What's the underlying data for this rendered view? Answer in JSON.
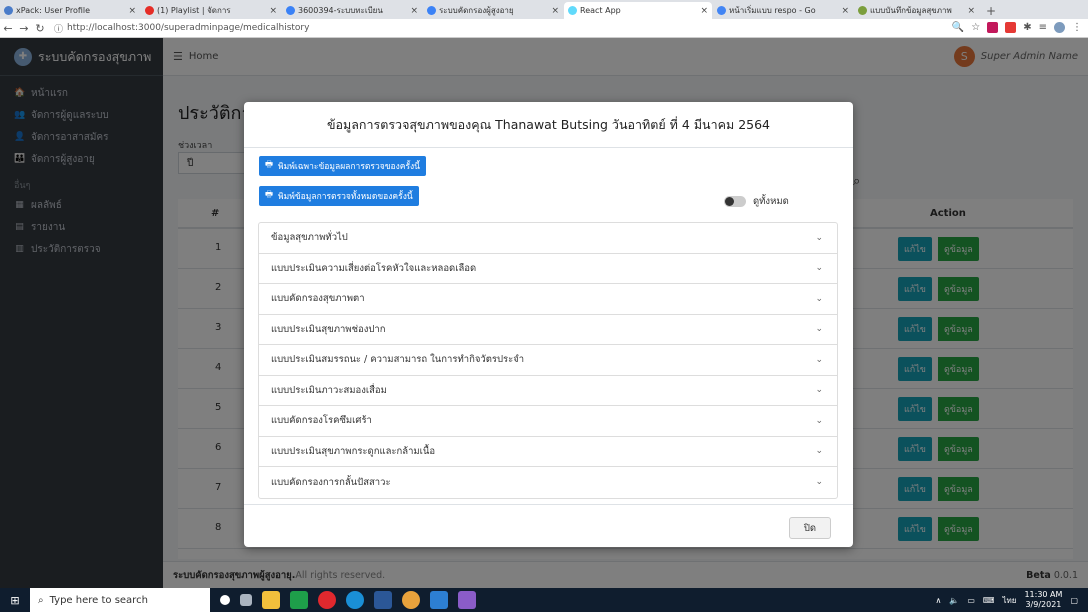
{
  "browser": {
    "tabs": [
      {
        "title": "xPack: User Profile",
        "color": "#4a7cc9",
        "active": false
      },
      {
        "title": "(1) Playlist | จัดการ",
        "color": "#e52d27",
        "active": false
      },
      {
        "title": "3600394-ระบบทะเบียน",
        "color": "#3b82f6",
        "active": false
      },
      {
        "title": "ระบบคัดกรองผู้สูงอายุ",
        "color": "#3b82f6",
        "active": false
      },
      {
        "title": "React App",
        "color": "#61dafb",
        "active": true
      },
      {
        "title": "หน้าเริ่มแบบ respo - Go",
        "color": "#4285f4",
        "active": false
      },
      {
        "title": "แบบบันทึกข้อมูลสุขภาพ",
        "color": "#7b9e3c",
        "active": false
      }
    ],
    "url": "http://localhost:3000/superadminpage/medicalhistory"
  },
  "sidebar": {
    "brand": "ระบบคัดกรองสุขภาพ",
    "items": [
      {
        "label": "หน้าแรก",
        "icon": "home-icon",
        "glyph": "🏠"
      },
      {
        "label": "จัดการผู้ดูแลระบบ",
        "icon": "users-cog-icon",
        "glyph": "👥"
      },
      {
        "label": "จัดการอาสาสมัคร",
        "icon": "user-icon",
        "glyph": "👤"
      },
      {
        "label": "จัดการผู้สูงอายุ",
        "icon": "users-icon",
        "glyph": "👪"
      }
    ],
    "section": "อื่นๆ",
    "items2": [
      {
        "label": "ผลลัพธ์",
        "icon": "table-icon",
        "glyph": "▦"
      },
      {
        "label": "รายงาน",
        "icon": "file-icon",
        "glyph": "▤"
      },
      {
        "label": "ประวัติการตรวจ",
        "icon": "book-icon",
        "glyph": "▥"
      }
    ]
  },
  "topnav": {
    "home": "Home",
    "user_initial": "S",
    "user_name": "Super Admin Name"
  },
  "page": {
    "title": "ประวัติการตรวจ",
    "filter_label": "ช่วงเวลา",
    "filter_value": "ปี",
    "table_headers": {
      "num": "#",
      "action": "Action"
    },
    "rows": [
      "1",
      "2",
      "3",
      "4",
      "5",
      "6",
      "7",
      "8"
    ],
    "edit_label": "แก้ไข",
    "view_label": "ดูข้อมูล"
  },
  "footer": {
    "brand": "ระบบคัดกรองสุขภาพผู้สูงอายุ.",
    "rights": "All rights reserved.",
    "version_label": "Beta",
    "version": "0.0.1"
  },
  "modal": {
    "title": "ข้อมูลการตรวจสุขภาพของคุณ Thanawat Butsing วันอาทิตย์ ที่ 4 มีนาคม 2564",
    "print_this_label": "พิมพ์เฉพาะข้อมูลผลการตรวจของครั้งนี้",
    "print_all_label": "พิมพ์ข้อมูลการตรวจทั้งหมดของครั้งนี้",
    "toggle_label": "ดูทั้งหมด",
    "sections": [
      "ข้อมูลสุขภาพทั่วไป",
      "แบบประเมินความเสี่ยงต่อโรคหัวใจและหลอดเลือด",
      "แบบคัดกรองสุขภาพตา",
      "แบบประเมินสุขภาพช่องปาก",
      "แบบประเมินสมรรถนะ / ความสามารถ ในการทำกิจวัตรประจำ",
      "แบบประเมินภาวะสมองเสื่อม",
      "แบบคัดกรองโรคซึมเศร้า",
      "แบบประเมินสุขภาพกระดูกและกล้ามเนื้อ",
      "แบบคัดกรองการกลั้นปัสสาวะ"
    ],
    "close_label": "ปิด"
  },
  "taskbar": {
    "search_placeholder": "Type here to search",
    "lang": "ไทย",
    "time": "11:30 AM",
    "date": "3/9/2021"
  }
}
